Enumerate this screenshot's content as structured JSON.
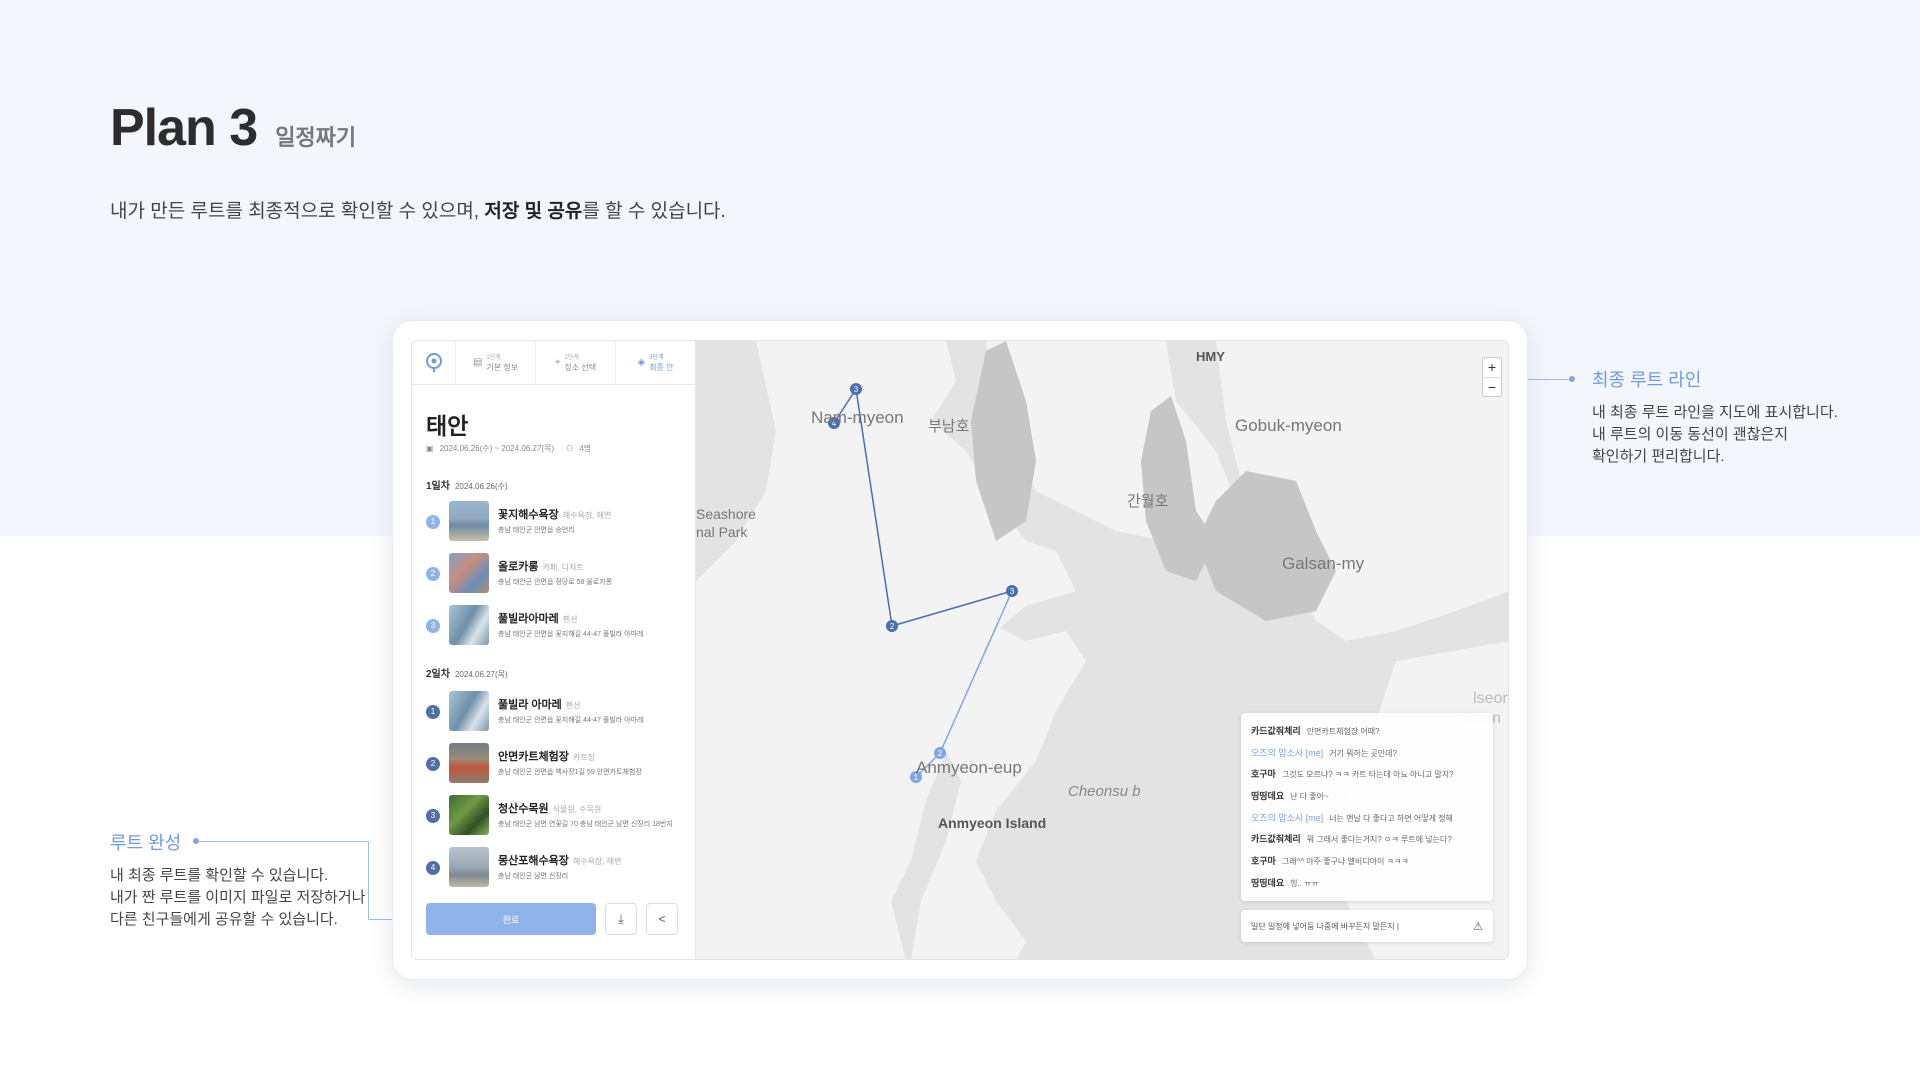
{
  "page": {
    "title": "Plan 3",
    "subtitle": "일정짜기",
    "desc_pre": "내가 만든 루트를 최종적으로 확인할 수 있으며, ",
    "desc_bold": "저장 및 공유",
    "desc_post": "를 할 수 있습니다."
  },
  "annotations": {
    "route_line": {
      "title": "최종 루트 라인",
      "lines": [
        "내 최종 루트 라인을 지도에 표시합니다.",
        "내 루트의 이동 동선이 괜찮은지",
        "확인하기 편리합니다."
      ]
    },
    "route_done": {
      "title": "루트 완성",
      "lines": [
        "내 최종 루트를 확인할 수 있습니다.",
        "내가 짠 루트를 이미지 파일로 저장하거나",
        "다른 친구들에게 공유할 수 있습니다."
      ]
    }
  },
  "app": {
    "tabs": [
      {
        "step": "1단계",
        "name": "기본 정보",
        "icon": "document-icon"
      },
      {
        "step": "2단계",
        "name": "장소 선택",
        "icon": "pin-icon"
      },
      {
        "step": "3단계",
        "name": "최종 안",
        "icon": "shield-icon",
        "active": true
      }
    ],
    "city": "태안",
    "dates": "2024.06.26(수) ~ 2024.06.27(목)",
    "people": "4명",
    "days": [
      {
        "label": "1일차",
        "date": "2024.06.26(수)",
        "places": [
          {
            "num": "1",
            "name": "꽃지해수욕장",
            "cat": "해수욕장, 해변",
            "addr": "충남 태안군 안면읍 승언리"
          },
          {
            "num": "2",
            "name": "올로카롱",
            "cat": "카페, 디저트",
            "addr": "충남 태안군 안면읍 정당로 58 올로카롱"
          },
          {
            "num": "3",
            "name": "풀빌라아마레",
            "cat": "펜션",
            "addr": "충남 태안군 안면읍 꽃지해길 44-47 풀빌라 아마레"
          }
        ]
      },
      {
        "label": "2일차",
        "date": "2024.06.27(목)",
        "places": [
          {
            "num": "1",
            "name": "풀빌라 아마레",
            "cat": "펜션",
            "addr": "충남 태안군 안면읍 꽃지해길 44-47 풀빌라 아마레"
          },
          {
            "num": "2",
            "name": "안면카트체험장",
            "cat": "카트장",
            "addr": "충남 태안군 안면읍 백사장1길 59 안면카트체험장"
          },
          {
            "num": "3",
            "name": "청산수목원",
            "cat": "식물원, 수목원",
            "addr": "충남 태안군 남면 연꽃길 70 충남 태안군 남면 신장리 18번지"
          },
          {
            "num": "4",
            "name": "몽산포해수욕장",
            "cat": "해수욕장, 해변",
            "addr": "충남 태안군 남면 신장리"
          }
        ]
      }
    ],
    "done_button": "완료",
    "download_icon": "download-icon",
    "share_icon": "share-icon"
  },
  "map": {
    "labels": [
      "HMY",
      "Nam-myeon",
      "부남호",
      "Gobuk-myeon",
      "간월호",
      "Seashore",
      "nal Park",
      "Galsan-my",
      "Anmyeon-eup",
      "Anmyeon Island",
      "Cheonsu b",
      "lseong",
      "myeon"
    ],
    "zoom_in": "+",
    "zoom_out": "−",
    "route_markers": [
      "1",
      "2",
      "3",
      "4",
      "2",
      "3",
      "1"
    ],
    "route_color": "#4a6fb0",
    "route_color_light": "#7fa6e3"
  },
  "chat": {
    "messages": [
      {
        "who": "카드값줘체리",
        "me": false,
        "text": "안면카트체험장 어때?"
      },
      {
        "who": "오즈의 맙소사 [me]",
        "me": true,
        "text": "거기 뭐하는 곳인데?"
      },
      {
        "who": "호구마",
        "me": false,
        "text": "그것도 모르냐? ㅋㅋ 카트 타는데 아뇨 아니고 말지?"
      },
      {
        "who": "띵띵데요",
        "me": false,
        "text": "난 다 좋아~"
      },
      {
        "who": "오즈의 맙소사 [me]",
        "me": true,
        "text": "너는 맨날 다 좋다고 하면 어떻게 정해"
      },
      {
        "who": "카드값줘체리",
        "me": false,
        "text": "뭐 그래서 좋다는거지? ㅇㅋ 루트에 넣는다?"
      },
      {
        "who": "호구마",
        "me": false,
        "text": "그래^^ 아주 좋구나 엘비디아이 ㅋㅋㅋ"
      },
      {
        "who": "띵띵데요",
        "me": false,
        "text": "힝.. ㅠㅠ"
      }
    ],
    "input_value": "일단 일정에 넣어둠 나중에 바꾸든지 말든지 |",
    "send_icon": "send-icon"
  },
  "colors": {
    "accent": "#6d9be0",
    "band": "#f3f6fc",
    "map_water": "#e3e3e3",
    "map_land": "#f3f3f3",
    "map_dark": "#c6c6c6"
  }
}
